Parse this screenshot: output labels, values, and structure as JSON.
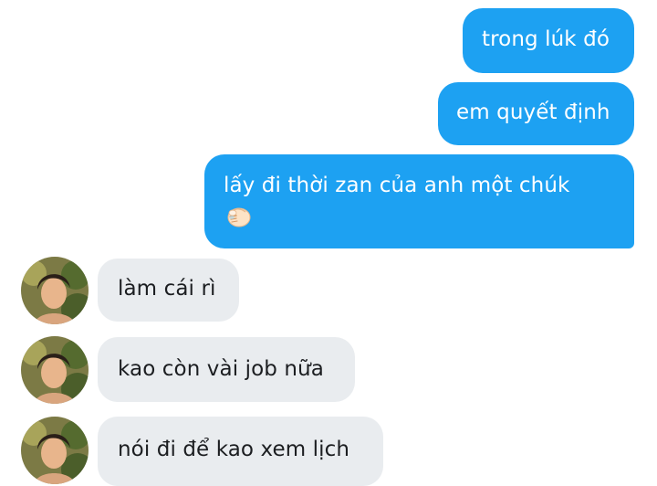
{
  "messages": {
    "outgoing": [
      {
        "text": "trong lúk đó"
      },
      {
        "text": "em quyết định"
      },
      {
        "text": "lấy đi thời zan của anh một chúk",
        "emoji": "pinching-hand-emoji"
      }
    ],
    "incoming": [
      {
        "text": "làm cái rì"
      },
      {
        "text": "kao còn vài job nữa"
      },
      {
        "text": "nói đi để kao xem lịch"
      }
    ]
  },
  "colors": {
    "outgoing_bubble": "#1da1f2",
    "incoming_bubble": "#e9ecef",
    "incoming_text": "#1c1e21",
    "outgoing_text": "#ffffff",
    "background": "#ffffff"
  },
  "icons": {
    "avatar": "contact-avatar-photo",
    "emoji": "pinching-hand-emoji"
  }
}
